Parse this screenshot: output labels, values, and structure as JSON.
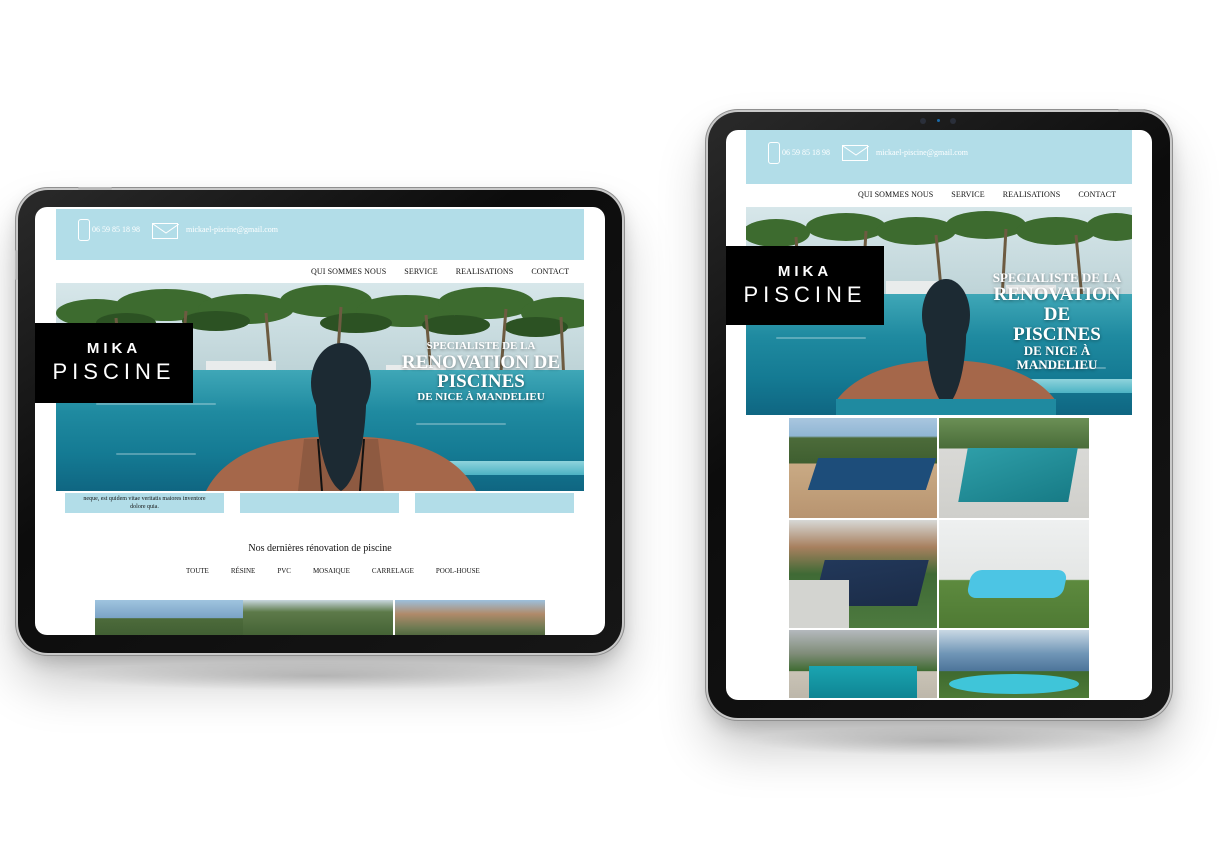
{
  "site": {
    "phone": "06 59 85 18 98",
    "email": "mickael-piscine@gmail.com",
    "nav": [
      "QUI SOMMES NOUS",
      "SERVICE",
      "REALISATIONS",
      "CONTACT"
    ],
    "logo": {
      "line1": "MIKA",
      "line2": "PISCINE"
    },
    "hero": {
      "line1": "SPECIALISTE DE LA",
      "line2": "RENOVATION DE",
      "line3": "PISCINES",
      "line4": "DE NICE À MANDELIEU",
      "line4a": "DE NICE À",
      "line4b": "MANDELIEU"
    },
    "card_text_1": "neque, est quidem vitae veritatis maiores inventore",
    "card_text_2": "dolore quia.",
    "section_title": "Nos dernières rénovation de piscine",
    "filters": [
      "TOUTE",
      "RÉSINE",
      "PVC",
      "MOSAIQUE",
      "CARRELAGE",
      "POOL-HOUSE"
    ]
  },
  "colors": {
    "accent": "#b2dde8",
    "logo_bg": "#000000",
    "text": "#111111",
    "device_frame": "#111111"
  },
  "devices": [
    "tablet-landscape",
    "tablet-portrait"
  ]
}
